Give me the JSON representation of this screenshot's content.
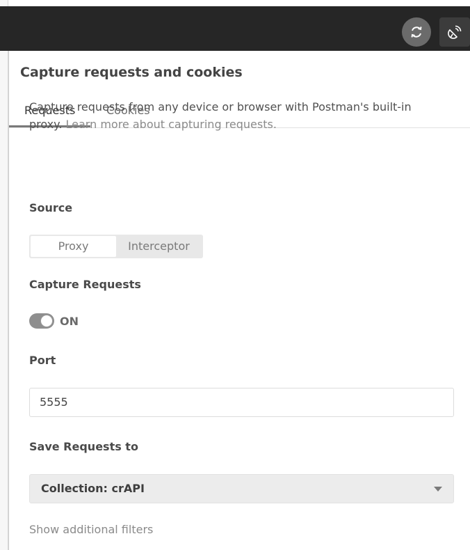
{
  "panel": {
    "title": "Capture requests and cookies",
    "tabs": [
      {
        "label": "Requests",
        "active": true
      },
      {
        "label": "Cookies",
        "active": false
      }
    ],
    "description": "Capture requests from any device or browser with Postman's built-in proxy.",
    "learn_more": "Learn more about capturing requests."
  },
  "source": {
    "label": "Source",
    "options": [
      "Proxy",
      "Interceptor"
    ],
    "selected": "Proxy"
  },
  "capture": {
    "label": "Capture Requests",
    "state": "ON"
  },
  "port": {
    "label": "Port",
    "value": "5555"
  },
  "save": {
    "label": "Save Requests to",
    "selected": "Collection: crAPI"
  },
  "filters": {
    "label": "Show additional filters"
  },
  "icons": {
    "sync": "sync-icon",
    "capture": "satellite-dish-icon",
    "dropdown": "chevron-down-icon"
  },
  "colors": {
    "topbar": "#262626",
    "toggle_on": "#8e8e8e"
  }
}
